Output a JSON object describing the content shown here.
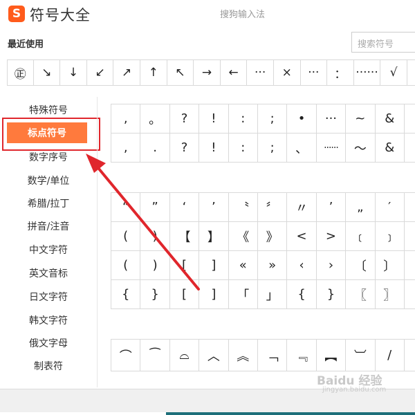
{
  "header": {
    "logo_letter": "S",
    "title": "符号大全",
    "ime_name": "搜狗输入法"
  },
  "recent": {
    "label": "最近使用",
    "items": [
      "㊣",
      "↘",
      "↓",
      "↙",
      "↗",
      "↑",
      "↖",
      "→",
      "←",
      "···",
      "×",
      "···",
      "：",
      "······",
      "√"
    ]
  },
  "search": {
    "placeholder": "搜索符号"
  },
  "sidebar": {
    "items": [
      {
        "label": "特殊符号"
      },
      {
        "label": "标点符号",
        "active": true
      },
      {
        "label": "数字序号"
      },
      {
        "label": "数学/单位"
      },
      {
        "label": "希腊/拉丁"
      },
      {
        "label": "拼音/注音"
      },
      {
        "label": "中文字符"
      },
      {
        "label": "英文音标"
      },
      {
        "label": "日文字符"
      },
      {
        "label": "韩文字符"
      },
      {
        "label": "俄文字母"
      },
      {
        "label": "制表符"
      }
    ]
  },
  "grid_punct_1": [
    ",",
    "。",
    "?",
    "!",
    ":",
    ";",
    "•",
    "···",
    "~",
    "&",
    "",
    ",",
    ".",
    "?",
    "!",
    ":",
    ";",
    "、",
    "······",
    "～",
    "&",
    "("
  ],
  "grid_punct_2": [
    "“",
    "”",
    "‘",
    "’",
    "〝",
    "〞",
    "〃",
    "’",
    "„",
    "′",
    "",
    "(",
    ")",
    "【",
    "】",
    "《",
    "》",
    "<",
    ">",
    "﹝",
    "﹞",
    "",
    "(",
    ")",
    "[",
    "]",
    "«",
    "»",
    "‹",
    "›",
    "〔",
    "〕",
    "",
    "{",
    "}",
    "[",
    "]",
    "「",
    "」",
    "{",
    "}",
    "〖",
    "〗",
    ""
  ],
  "grid_punct_3": [
    "⌒",
    "⁀",
    "⌓",
    "︿",
    "︽",
    "﹁",
    "﹃",
    "︻",
    "︺",
    "/",
    ""
  ],
  "watermark": {
    "brand": "Baidu 经验",
    "url": "jingyan.baidu.com"
  },
  "colors": {
    "brand_orange": "#ff5b1c",
    "active_bg": "#ff7a3d",
    "annotation_red": "#e0262c"
  }
}
